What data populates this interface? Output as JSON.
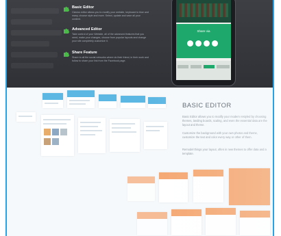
{
  "features": [
    {
      "title": "Basic Editor",
      "icon": "puzzle-icon",
      "description": "Clavius editor allows you to modify your website, keyboard to blue and many, choose style and more. Select, update and save all your content."
    },
    {
      "title": "Advanced Editor",
      "icon": "puzzle-icon",
      "description": "Take control of your Website, all of the advanced features that you need, make your changes, choose from popular layouts and change your site completely customize it."
    },
    {
      "title": "Share Feature",
      "icon": "puzzle-icon",
      "description": "Share to all the social networks where do their friend, in their work and follow to share your link from the Facebook page."
    }
  ],
  "phone": {
    "share_title": "Share via",
    "social_icons": [
      "facebook-icon",
      "twitter-icon",
      "google-plus-icon",
      "email-icon"
    ]
  },
  "editor": {
    "title": "BASIC EDITOR",
    "paragraphs": [
      "Basic Editor allows you to modify your modern restyled by choosing themes, landing boards, scaling, and even the essential data are the layout and theme.",
      "Customize the background with your own photos and theme, customize the text and color every way or other of them.",
      "Remodel things your layout, often in new themes to offer data and a template."
    ]
  },
  "colors": {
    "accent_blue": "#27a2e6",
    "dark_bg": "#35373c",
    "share_green": "#1ea86b",
    "feature_icon_green": "#4bb84a",
    "mock_orange": "#f5a873",
    "mock_blue": "#5db7e3"
  }
}
